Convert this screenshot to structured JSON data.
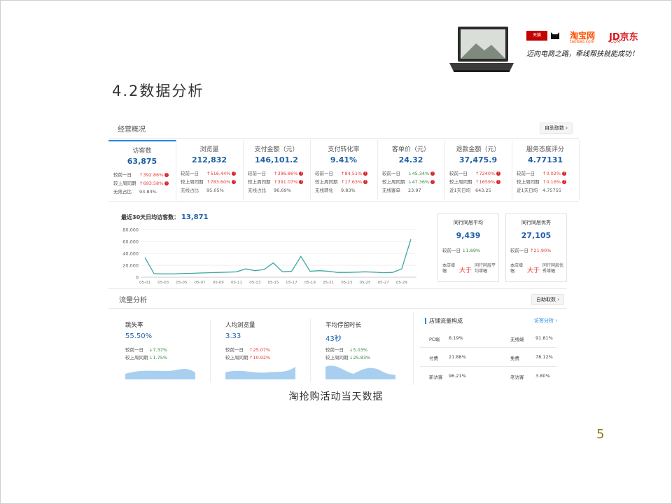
{
  "slide": {
    "heading": "4.2数据分析",
    "caption": "淘抢购活动当天数据",
    "page_number": "5"
  },
  "brand": {
    "tmall": "天猫 TMALL.COM",
    "taobao": "淘宝网",
    "taobao_sub": "taobao.com",
    "jd": "JD京东",
    "jd_sub": ".COM",
    "slogan": "迈向电商之路，牵线帮扶就能成功！"
  },
  "overview": {
    "title": "经营概况",
    "help": "自助取数 ›",
    "metrics": [
      {
        "name": "访客数",
        "value": "63,875",
        "r1k": "较前一日",
        "r1v": "↑392.86%",
        "r1c": "up",
        "r2k": "较上周同期",
        "r2v": "↑693.58%",
        "r2c": "up",
        "r3k": "无线占比",
        "r3v": "93.83%"
      },
      {
        "name": "浏览量",
        "value": "212,832",
        "r1k": "较前一日",
        "r1v": "↑516.44%",
        "r1c": "up",
        "r2k": "较上周同期",
        "r2v": "↑783.60%",
        "r2c": "up",
        "r3k": "无线占比",
        "r3v": "95.05%"
      },
      {
        "name": "支付金额（元）",
        "value": "146,101.2",
        "r1k": "较前一日",
        "r1v": "↑396.86%",
        "r1c": "up",
        "r2k": "较上周同期",
        "r2v": "↑391.07%",
        "r2c": "up",
        "r3k": "无线占比",
        "r3v": "96.69%"
      },
      {
        "name": "支付转化率",
        "value": "9.41%",
        "r1k": "较前一日",
        "r1v": "↑84.51%",
        "r1c": "up",
        "r2k": "较上周同期",
        "r2v": "↑17.63%",
        "r2c": "up",
        "r3k": "无线转化",
        "r3v": "9.83%"
      },
      {
        "name": "客单价（元）",
        "value": "24.32",
        "r1k": "较前一日",
        "r1v": "↓45.34%",
        "r1c": "down",
        "r2k": "较上周同期",
        "r2v": "↓47.36%",
        "r2c": "down",
        "r3k": "无线客单",
        "r3v": "23.97"
      },
      {
        "name": "退款金额（元）",
        "value": "37,475.9",
        "r1k": "较前一日",
        "r1v": "↑7240%",
        "r1c": "up",
        "r2k": "较上周同期",
        "r2v": "↑1659%",
        "r2c": "up",
        "r3k": "近1天日均",
        "r3v": "643.25"
      },
      {
        "name": "服务态度评分",
        "value": "4.77131",
        "r1k": "较前一日",
        "r1v": "↑0.02%",
        "r1c": "up",
        "r2k": "较上周同期",
        "r2v": "↑0.16%",
        "r2c": "up",
        "r3k": "近1天日均",
        "r3v": "4.75755"
      }
    ]
  },
  "visitor_chart": {
    "label": "最近30天日均访客数：",
    "avg": "13,871"
  },
  "chart_data": {
    "type": "line",
    "ylim": [
      0,
      80000
    ],
    "yticks": [
      "0",
      "20,000",
      "40,000",
      "60,000",
      "80,000"
    ],
    "xticks": [
      "05-01",
      "05-03",
      "05-05",
      "05-07",
      "05-09",
      "05-11",
      "05-13",
      "05-15",
      "05-17",
      "05-19",
      "05-21",
      "05-23",
      "05-25",
      "05-27",
      "05-29"
    ],
    "x": [
      "05-01",
      "05-02",
      "05-03",
      "05-04",
      "05-05",
      "05-06",
      "05-07",
      "05-08",
      "05-09",
      "05-10",
      "05-11",
      "05-12",
      "05-13",
      "05-14",
      "05-15",
      "05-16",
      "05-17",
      "05-18",
      "05-19",
      "05-20",
      "05-21",
      "05-22",
      "05-23",
      "05-24",
      "05-25",
      "05-26",
      "05-27",
      "05-28",
      "05-29",
      "05-30"
    ],
    "series": [
      {
        "values": [
          33000,
          6000,
          5500,
          5500,
          6000,
          6500,
          7000,
          7500,
          8000,
          8500,
          9000,
          14000,
          11000,
          13000,
          24000,
          9000,
          10000,
          35000,
          10000,
          11000,
          10000,
          8000,
          8000,
          8500,
          9000,
          8500,
          7500,
          8000,
          14000,
          64000
        ],
        "color": "#3aa7a3"
      }
    ]
  },
  "peers": [
    {
      "title": "同行同层平均",
      "value": "9,439",
      "cmp_k": "较前一日",
      "cmp_v": "↓1.69%",
      "cmp_c": "down",
      "a": "本店增幅",
      "b": "大于",
      "c": "同行同层平均增幅"
    },
    {
      "title": "同行同层优秀",
      "value": "27,105",
      "cmp_k": "较前一日",
      "cmp_v": "↑21.90%",
      "cmp_c": "up",
      "a": "本店增幅",
      "b": "大于",
      "c": "同行同层优秀增幅"
    }
  ],
  "traffic": {
    "title": "流量分析",
    "help": "自助取数 ›",
    "metrics": [
      {
        "name": "跳失率",
        "value": "55.50%",
        "r1k": "较前一日",
        "r1v": "↓7.37%",
        "r1c": "down",
        "r2k": "较上周同期",
        "r2v": "↓1.75%",
        "r2c": "down"
      },
      {
        "name": "人均浏览量",
        "value": "3.33",
        "r1k": "较前一日",
        "r1v": "↑25.07%",
        "r1c": "up",
        "r2k": "较上周同期",
        "r2v": "↑10.92%",
        "r2c": "up"
      },
      {
        "name": "平均停留时长",
        "value": "43秒",
        "r1k": "较前一日",
        "r1v": "↓5.03%",
        "r1c": "down",
        "r2k": "较上周同期",
        "r2v": "↓25.83%",
        "r2c": "down"
      }
    ],
    "composition_title": "店铺流量构成",
    "composition_link": "访客分析 ›",
    "composition": [
      {
        "k1": "PC端",
        "v1": "8.19%",
        "k2": "无线端",
        "v2": "91.81%"
      },
      {
        "k1": "付费",
        "v1": "21.88%",
        "k2": "免费",
        "v2": "78.12%"
      },
      {
        "k1": "新访客",
        "v1": "96.21%",
        "k2": "老访客",
        "v2": "3.80%"
      }
    ]
  }
}
